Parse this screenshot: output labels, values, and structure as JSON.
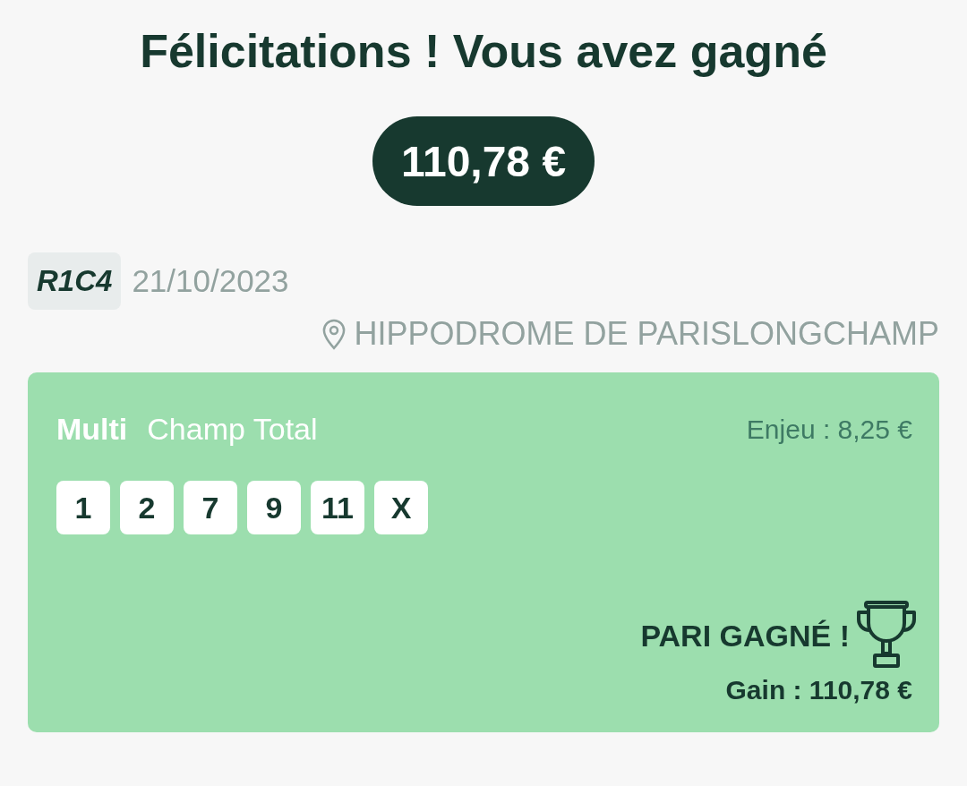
{
  "title": "Félicitations ! Vous avez gagné",
  "amount": "110,78 €",
  "race": {
    "code": "R1C4",
    "date": "21/10/2023",
    "venue": "HIPPODROME DE PARISLONGCHAMP"
  },
  "bet": {
    "type": "Multi",
    "formula": "Champ Total",
    "stake": "Enjeu : 8,25 €",
    "selections": [
      "1",
      "2",
      "7",
      "9",
      "11",
      "X"
    ],
    "result": "PARI GAGNÉ !",
    "gain": "Gain : 110,78 €"
  }
}
